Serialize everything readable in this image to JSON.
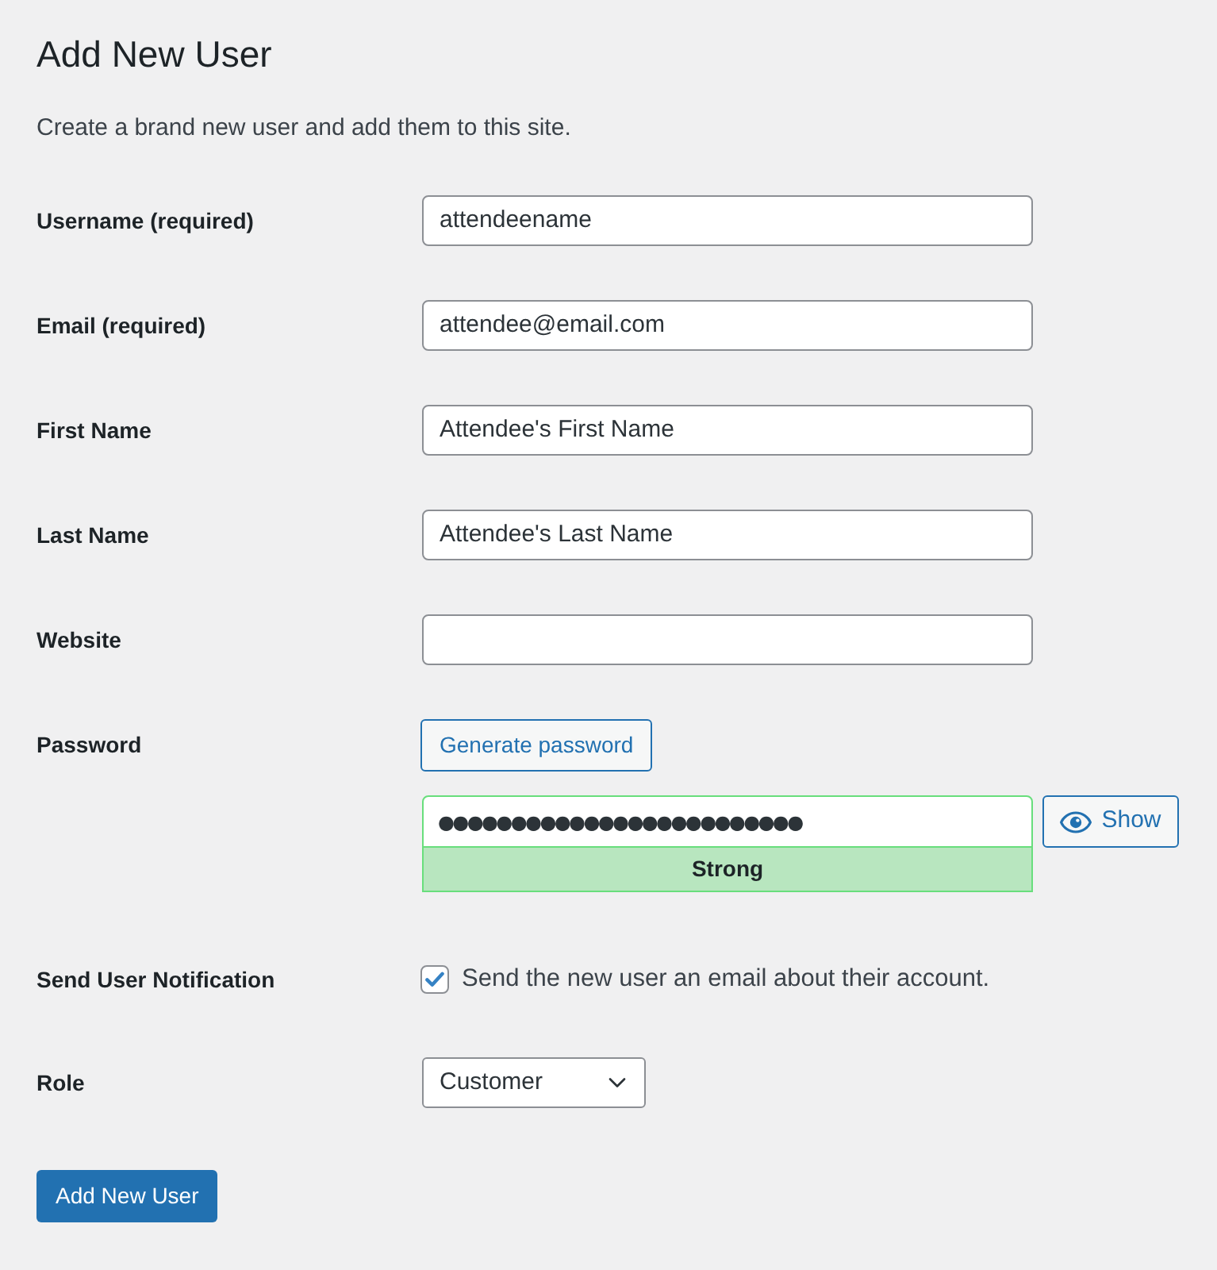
{
  "page": {
    "title": "Add New User",
    "description": "Create a brand new user and add them to this site."
  },
  "fields": [
    {
      "kind": "text",
      "label": "Username (required)",
      "value": "attendeename"
    },
    {
      "kind": "text",
      "label": "Email (required)",
      "value": "attendee@email.com"
    },
    {
      "kind": "text",
      "label": "First Name",
      "value": "Attendee's First Name"
    },
    {
      "kind": "text",
      "label": "Last Name",
      "value": "Attendee's Last Name"
    },
    {
      "kind": "text",
      "label": "Website"
    },
    {
      "kind": "password",
      "label": "Password",
      "generate_button": "Generate password",
      "value": "●●●●●●●●●●●●●●●●●●●●●●●●●",
      "toggle_button": "Show",
      "strength": {
        "label": "Strong",
        "kind": "strong"
      }
    },
    {
      "kind": "checkbox",
      "label": "Send User Notification",
      "checkbox_label": "Send the new user an email about their account.",
      "checked": true
    },
    {
      "kind": "select",
      "label": "Role",
      "value": "Customer"
    }
  ],
  "submit_button": "Add New User"
}
